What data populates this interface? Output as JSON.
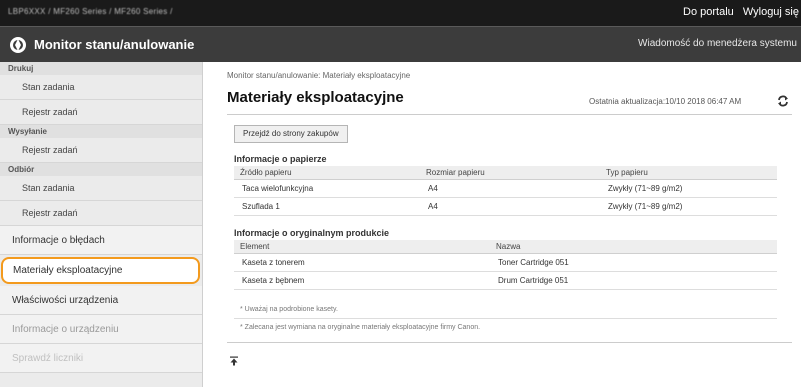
{
  "topbar": {
    "model": "LBP6XXX / MF260 Series / MF260 Series /",
    "portal_link": "Do portalu",
    "logout_link": "Wyloguj się"
  },
  "header": {
    "title": "Monitor stanu/anulowanie",
    "message_link": "Wiadomość do menedżera systemu",
    "icon": "remote-ui-logo-icon"
  },
  "sidebar": {
    "print_head": "Drukuj",
    "print_items": [
      "Stan zadania",
      "Rejestr zadań"
    ],
    "send_head": "Wysyłanie",
    "send_items": [
      "Rejestr zadań"
    ],
    "receive_head": "Odbiór",
    "receive_items": [
      "Stan zadania",
      "Rejestr zadań"
    ],
    "main_items": [
      "Informacje o błędach",
      "Materiały eksploatacyjne",
      "Właściwości urządzenia",
      "Informacje o urządzeniu",
      "Sprawdź liczniki"
    ]
  },
  "main": {
    "breadcrumb": "Monitor stanu/anulowanie: Materiały eksploatacyjne",
    "title": "Materiały eksploatacyjne",
    "last_update": "Ostatnia aktualizacja:10/10 2018 06:47 AM",
    "purchase_button": "Przejdź do strony zakupów",
    "paper": {
      "title": "Informacje o papierze",
      "headers": [
        "Źródło papieru",
        "Rozmiar papieru",
        "Typ papieru"
      ],
      "rows": [
        [
          "Taca wielofunkcyjna",
          "A4",
          "Zwykły (71~89 g/m2)"
        ],
        [
          "Szuflada 1",
          "A4",
          "Zwykły (71~89 g/m2)"
        ]
      ]
    },
    "cartridge": {
      "title": "Informacje o oryginalnym produkcie",
      "headers": [
        "Element",
        "Nazwa"
      ],
      "rows": [
        [
          "Kaseta z tonerem",
          "Toner Cartridge 051"
        ],
        [
          "Kaseta z bębnem",
          "Drum Cartridge 051"
        ]
      ]
    },
    "note1": "* Uważaj na podrobione kasety.",
    "note2": "* Zalecana jest wymiana na oryginalne materiały eksploatacyjne firmy Canon.",
    "accent_color": "#f39a1d"
  }
}
